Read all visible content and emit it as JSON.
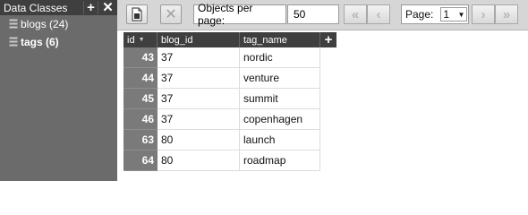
{
  "sidebar": {
    "title": "Data Classes",
    "add_icon": "+",
    "close_icon": "✕",
    "classes": [
      {
        "label": "blogs (24)",
        "icon": "database-icon"
      },
      {
        "label": "tags (6)",
        "icon": "database-icon",
        "selected": true
      }
    ]
  },
  "toolbar": {
    "objects_per_page_label": "Objects per page:",
    "objects_per_page_value": "50",
    "page_label": "Page:",
    "page_value": "1"
  },
  "grid": {
    "columns": [
      "id",
      "blog_id",
      "tag_name"
    ],
    "rows": [
      {
        "id": "43",
        "blog_id": "37",
        "tag_name": "nordic"
      },
      {
        "id": "44",
        "blog_id": "37",
        "tag_name": "venture"
      },
      {
        "id": "45",
        "blog_id": "37",
        "tag_name": "summit"
      },
      {
        "id": "46",
        "blog_id": "37",
        "tag_name": "copenhagen"
      },
      {
        "id": "63",
        "blog_id": "80",
        "tag_name": "launch"
      },
      {
        "id": "64",
        "blog_id": "80",
        "tag_name": "roadmap"
      }
    ]
  }
}
